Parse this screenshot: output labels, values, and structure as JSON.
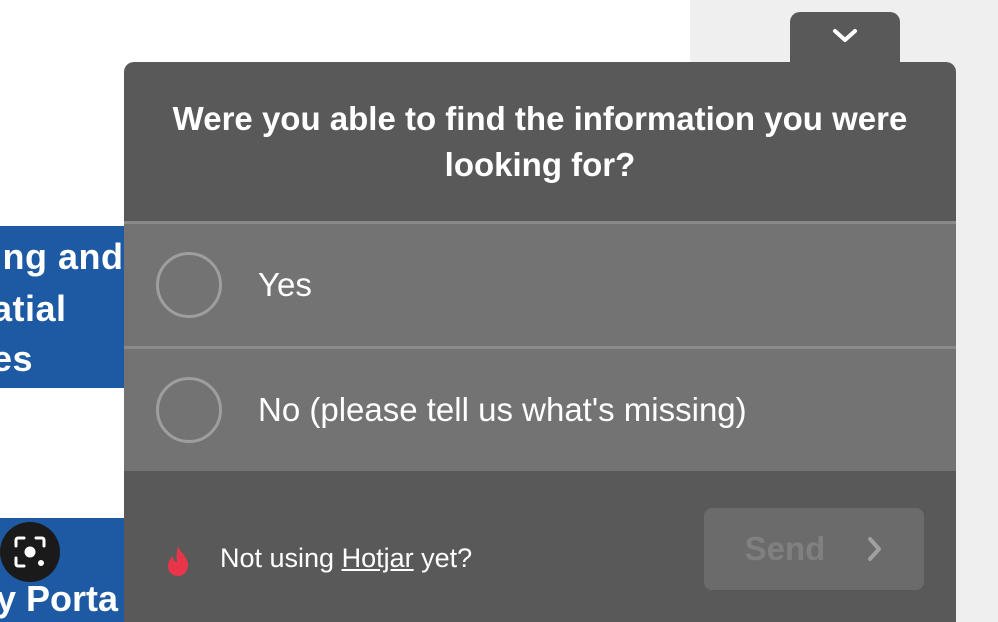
{
  "background": {
    "left_block_lines": [
      "ing and",
      "atial",
      "es"
    ],
    "bottom_block_text": "y Porta"
  },
  "widget": {
    "collapse_icon": "chevron-down-icon",
    "question": "Were you able to find the information you were looking for?",
    "options": [
      {
        "label": "Yes"
      },
      {
        "label": "No (please tell us what's missing)"
      }
    ],
    "footer": {
      "prefix": "Not using ",
      "link": "Hotjar",
      "suffix": " yet?",
      "icon": "flame-icon"
    },
    "send_label": "Send",
    "send_icon": "chevron-right-icon"
  },
  "colors": {
    "panel": "#595959",
    "option": "#737373",
    "flame": "#e8354a",
    "background_blue": "#1d5aa3"
  }
}
